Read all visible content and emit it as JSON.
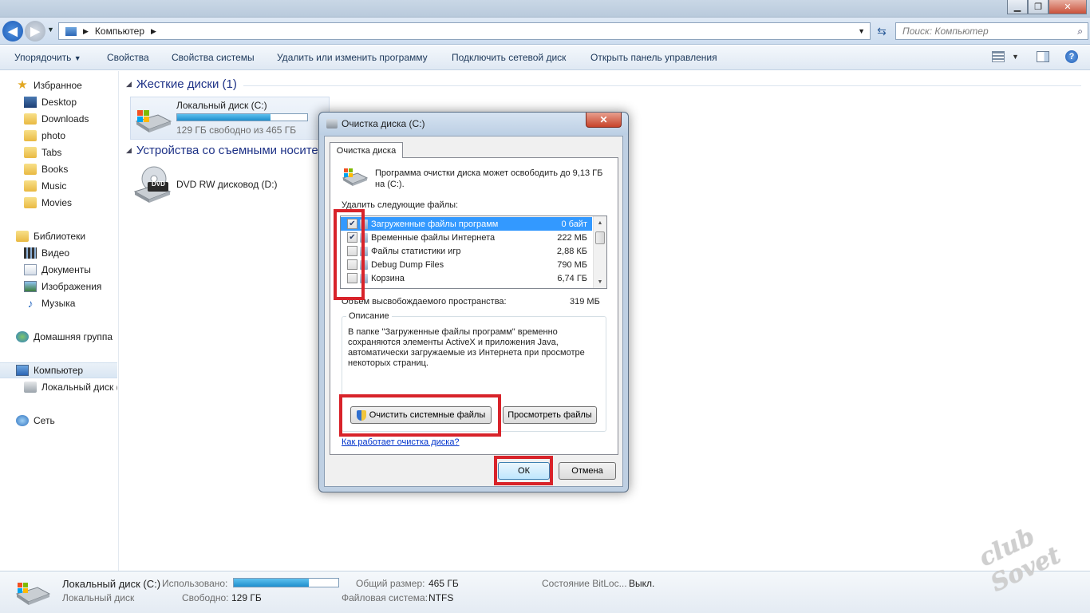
{
  "address": {
    "location": "Компьютер",
    "search_placeholder": "Поиск: Компьютер"
  },
  "toolbar": {
    "organize": "Упорядочить",
    "properties": "Свойства",
    "system_properties": "Свойства системы",
    "uninstall": "Удалить или изменить программу",
    "map_drive": "Подключить сетевой диск",
    "control_panel": "Открыть панель управления"
  },
  "sidebar": {
    "favorites": "Избранное",
    "fav_items": [
      "Desktop",
      "Downloads",
      "photo",
      "Tabs",
      "Books",
      "Music",
      "Movies"
    ],
    "libraries": "Библиотеки",
    "lib_items": [
      "Видео",
      "Документы",
      "Изображения",
      "Музыка"
    ],
    "homegroup": "Домашняя группа",
    "computer": "Компьютер",
    "local_disk": "Локальный диск (",
    "network": "Сеть"
  },
  "content": {
    "hard_disks_group": "Жесткие диски (1)",
    "disk_c_name": "Локальный диск (C:)",
    "disk_c_free": "129 ГБ свободно из 465 ГБ",
    "disk_c_used_fraction": 0.72,
    "removable_group": "Устройства со съемными носите",
    "dvd_name": "DVD RW дисковод (D:)",
    "dvd_label": "DVD"
  },
  "status": {
    "name": "Локальный диск (C:)",
    "type": "Локальный диск",
    "used_label": "Использовано:",
    "free_label": "Свободно:",
    "free_value": "129 ГБ",
    "total_label": "Общий размер:",
    "total_value": "465 ГБ",
    "fs_label": "Файловая система:",
    "fs_value": "NTFS",
    "bitlocker_label": "Состояние BitLoc...",
    "bitlocker_value": "Выкл."
  },
  "dialog": {
    "title": "Очистка диска  (C:)",
    "close": "✕",
    "tab": "Очистка диска",
    "intro_line1": "Программа очистки диска может освободить до 9,13 ГБ",
    "intro_line2": "на  (C:).",
    "delete_label": "Удалить следующие файлы:",
    "files": [
      {
        "name": "Загруженные файлы программ",
        "size": "0 байт",
        "checked": true,
        "selected": true
      },
      {
        "name": "Временные файлы Интернета",
        "size": "222 МБ",
        "checked": true,
        "selected": false
      },
      {
        "name": "Файлы статистики игр",
        "size": "2,88 КБ",
        "checked": false,
        "selected": false
      },
      {
        "name": "Debug Dump Files",
        "size": "790 МБ",
        "checked": false,
        "selected": false
      },
      {
        "name": "Корзина",
        "size": "6,74 ГБ",
        "checked": false,
        "selected": false
      }
    ],
    "space_label": "Объем высвобождаемого пространства:",
    "space_value": "319 МБ",
    "description_title": "Описание",
    "description_l1": "В папке \"Загруженные файлы программ\" временно",
    "description_l2": "сохраняются элементы ActiveX и приложения Java,",
    "description_l3": "автоматически загружаемые из Интернета при просмотре",
    "description_l4": "некоторых страниц.",
    "clean_system": "Очистить системные файлы",
    "view_files": "Просмотреть файлы",
    "help_link": "Как работает очистка диска?",
    "ok": "ОК",
    "cancel": "Отмена"
  },
  "watermark": "club Sovet",
  "colors": {
    "highlight": "#d8232a",
    "selection": "#3399ff",
    "link": "#0033cc"
  }
}
